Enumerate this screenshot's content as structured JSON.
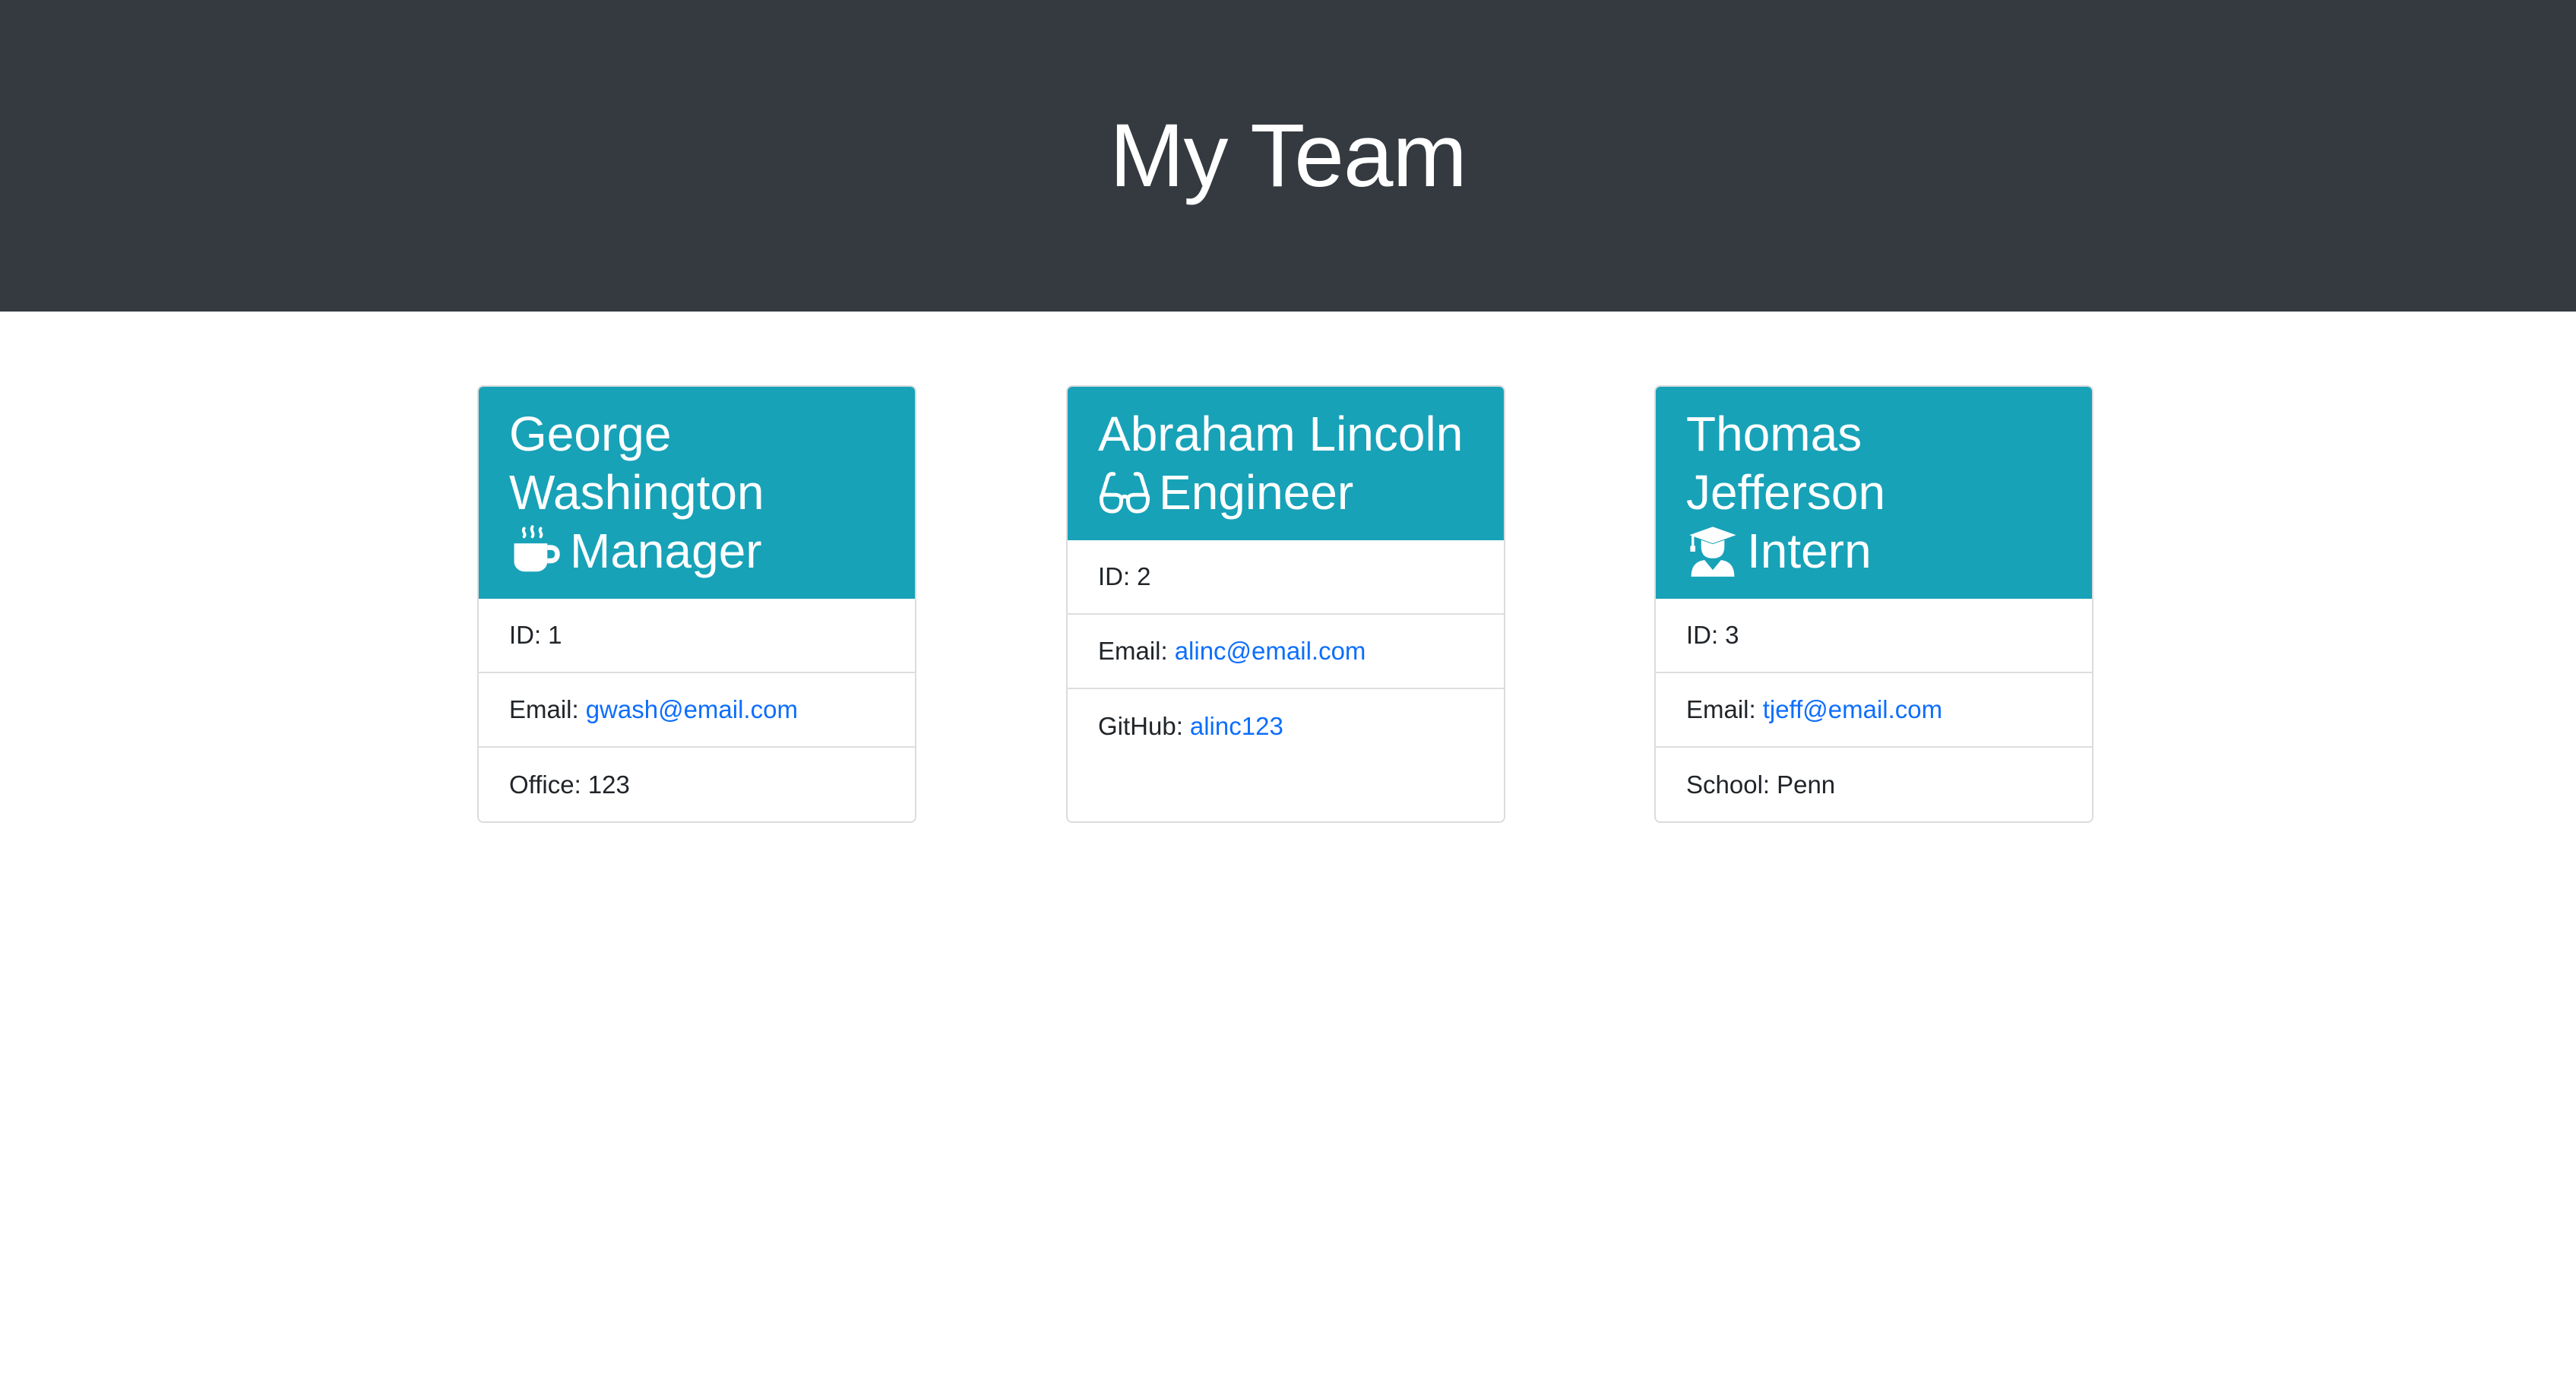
{
  "header": {
    "title": "My Team"
  },
  "colors": {
    "header_bg": "#343a40",
    "card_head_bg": "#17a2b8",
    "link": "#0d6efd"
  },
  "team": [
    {
      "name_line1": "George",
      "name_line2": "Washington",
      "role": "Manager",
      "role_icon": "mug-hot-icon",
      "id_label": "ID:",
      "id_value": "1",
      "email_label": "Email:",
      "email": "gwash@email.com",
      "extra_label": "Office:",
      "extra_value": "123"
    },
    {
      "name_line1": "Abraham Lincoln",
      "role": "Engineer",
      "role_icon": "glasses-icon",
      "id_label": "ID:",
      "id_value": "2",
      "email_label": "Email:",
      "email": "alinc@email.com",
      "extra_label": "GitHub:",
      "extra_value": "alinc123"
    },
    {
      "name_line1": "Thomas",
      "name_line2": "Jefferson",
      "role": "Intern",
      "role_icon": "user-graduate-icon",
      "id_label": "ID:",
      "id_value": "3",
      "email_label": "Email:",
      "email": "tjeff@email.com",
      "extra_label": "School:",
      "extra_value": "Penn"
    }
  ]
}
